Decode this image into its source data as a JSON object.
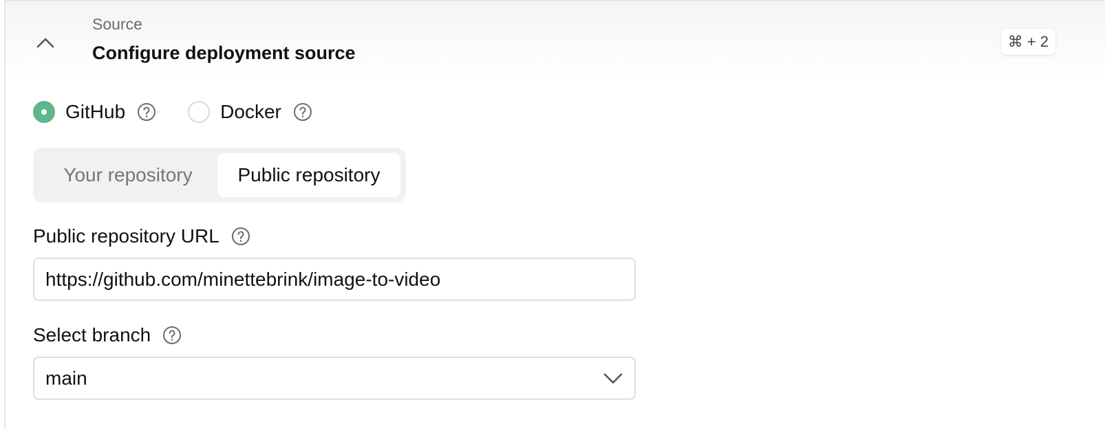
{
  "header": {
    "section_label": "Source",
    "title": "Configure deployment source",
    "shortcut": "⌘ + 2"
  },
  "source_type": {
    "options": [
      {
        "label": "GitHub",
        "selected": true
      },
      {
        "label": "Docker",
        "selected": false
      }
    ]
  },
  "repo_tabs": {
    "tabs": [
      {
        "label": "Your repository",
        "active": false
      },
      {
        "label": "Public repository",
        "active": true
      }
    ]
  },
  "repo_url": {
    "label": "Public repository URL",
    "value": "https://github.com/minettebrink/image-to-video"
  },
  "branch": {
    "label": "Select branch",
    "value": "main"
  },
  "colors": {
    "accent": "#5fb68a",
    "border": "#dedede",
    "muted_text": "#6b6b6b"
  },
  "icons": {
    "collapse": "chevron-up-icon",
    "help": "question-circle-icon",
    "dropdown": "chevron-down-icon"
  }
}
